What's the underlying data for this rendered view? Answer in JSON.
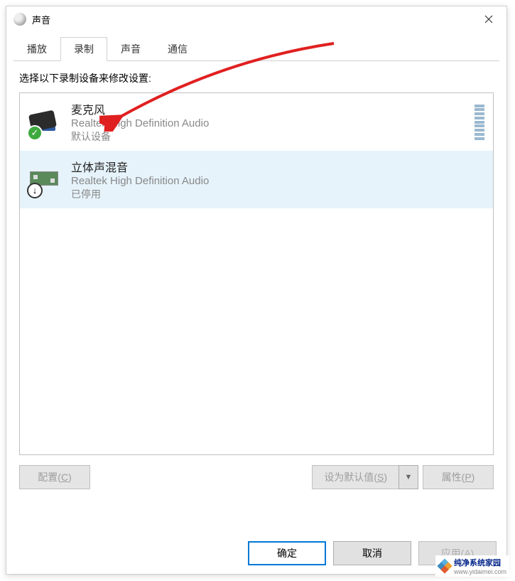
{
  "titlebar": {
    "title": "声音"
  },
  "tabs": {
    "play": "播放",
    "record": "录制",
    "sound": "声音",
    "comm": "通信"
  },
  "instruction": "选择以下录制设备来修改设置:",
  "devices": [
    {
      "name": "麦克风",
      "driver": "Realtek High Definition Audio",
      "status": "默认设备",
      "badge": "check",
      "type": "mic",
      "selected": false,
      "meter": true
    },
    {
      "name": "立体声混音",
      "driver": "Realtek High Definition Audio",
      "status": "已停用",
      "badge": "down",
      "type": "stereo",
      "selected": true,
      "meter": false
    }
  ],
  "buttons": {
    "config": "配置",
    "config_u": "C",
    "set_default": "设为默认值",
    "set_default_u": "S",
    "properties": "属性",
    "properties_u": "P",
    "ok": "确定",
    "cancel": "取消",
    "apply": "应用",
    "apply_u": "A"
  },
  "watermark": {
    "brand": "纯净系统家园",
    "url": "www.yidaimei.com"
  }
}
